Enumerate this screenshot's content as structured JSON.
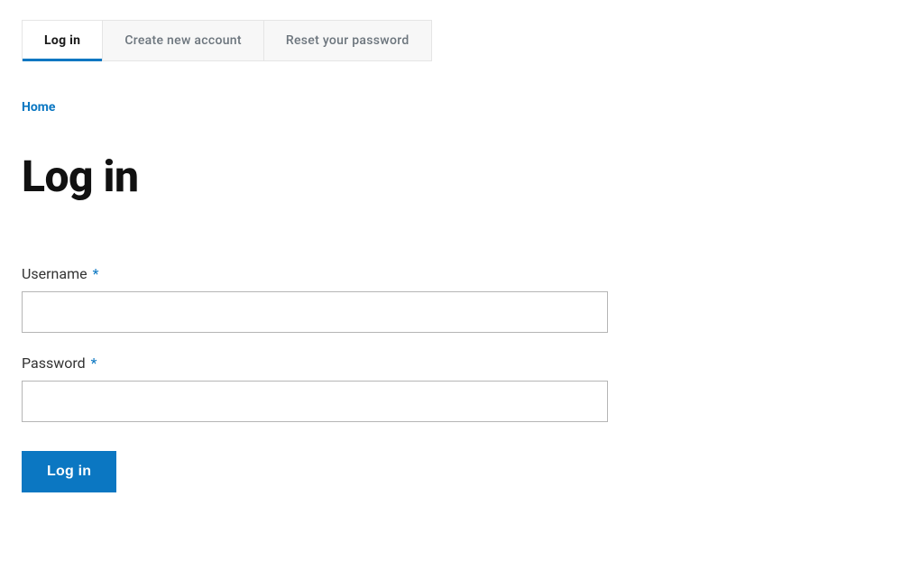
{
  "tabs": {
    "login": "Log in",
    "create": "Create new account",
    "reset": "Reset your password"
  },
  "breadcrumb": {
    "home": "Home"
  },
  "page": {
    "title": "Log in"
  },
  "form": {
    "username_label": "Username",
    "password_label": "Password",
    "required_marker": "*",
    "submit_label": "Log in"
  }
}
